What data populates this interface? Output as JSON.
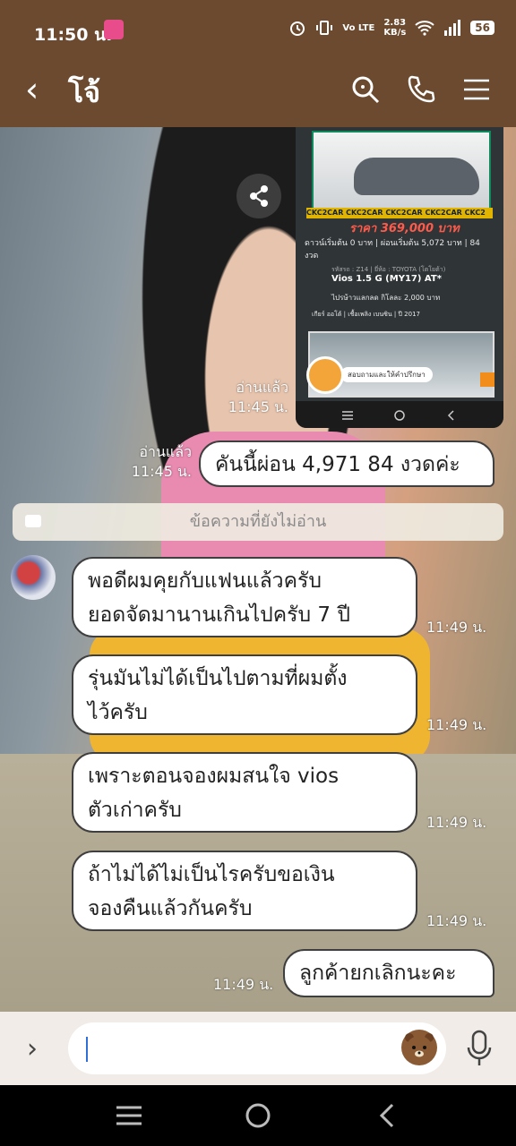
{
  "status_bar": {
    "time": "11:50 น.",
    "net_type": "Vo LTE",
    "speed_value": "2.83",
    "speed_unit": "KB/s",
    "battery": "56"
  },
  "header": {
    "title": "โจ้"
  },
  "screenshot": {
    "band_text": "CKC2CAR CKC2CAR CKC2CAR CKC2CAR CKC2",
    "price": "ราคา 369,000 บาท",
    "down_line": "ดาวน์เริ่มต้น 0 บาท | ผ่อนเริ่มต้น 5,072 บาท | 84 งวด",
    "meta": "รหัสรถ : Z14 | ยี่ห้อ : TOYOTA (โตโยต้า)",
    "model": "Vios 1.5 G (MY17) AT*",
    "promo": "ไปรษ้าวแลกลด กิโลละ 2,000 บาท",
    "specs": "เกียร์ ออโต้ | เชื้อเพลิง เบนซิน | ปี 2017",
    "consult": "สอบถามและให้คำปรึกษา"
  },
  "messages": {
    "image_read": "อ่านแล้ว",
    "image_time": "11:45 น.",
    "out1_read": "อ่านแล้ว",
    "out1_time": "11:45 น.",
    "out1_text": "คันนี้ผ่อน 4,971 84 งวดค่ะ",
    "unread_divider": "ข้อความที่ยังไม่อ่าน",
    "in": [
      {
        "line1": "พอดีผมคุยกับแฟนแล้วครับ",
        "line2": "ยอดจัดมานานเกินไปครับ 7 ปี",
        "time": "11:49 น."
      },
      {
        "line1": "รุ่นมันไม่ได้เป็นไปตามที่ผมตั้ง",
        "line2": "ไว้ครับ",
        "time": "11:49 น."
      },
      {
        "line1": "เพราะตอนจองผมสนใจ vios",
        "line2": "ตัวเก่าครับ",
        "time": "11:49 น."
      },
      {
        "line1": "ถ้าไม่ได้ไม่เป็นไรครับขอเงิน",
        "line2": "จองคืนแล้วกันครับ",
        "time": "11:49 น."
      }
    ],
    "out2_time": "11:49 น.",
    "out2_text": "ลูกค้ายกเลิกนะคะ"
  },
  "icons": {
    "back": "back-arrow-icon",
    "search": "search-icon",
    "call": "phone-icon",
    "menu": "hamburger-menu-icon",
    "share": "share-icon",
    "sticker": "bear-sticker-icon",
    "mic": "microphone-icon"
  },
  "colors": {
    "header": "#6b4a2f",
    "bubble_border": "#3f3f3f",
    "input_bg": "#f1ece7"
  }
}
